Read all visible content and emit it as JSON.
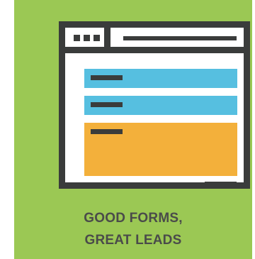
{
  "caption": {
    "line1": "GOOD FORMS,",
    "line2": "GREAT LEADS"
  },
  "colors": {
    "background": "#9bc854",
    "frame": "#3a3c3b",
    "field_blue": "#56bfe0",
    "field_orange": "#f3b03b",
    "caption_text": "#4a4b4a"
  },
  "illustration": {
    "icon": "browser-form-icon",
    "fields": [
      "text-field",
      "text-field",
      "textarea-field"
    ]
  }
}
